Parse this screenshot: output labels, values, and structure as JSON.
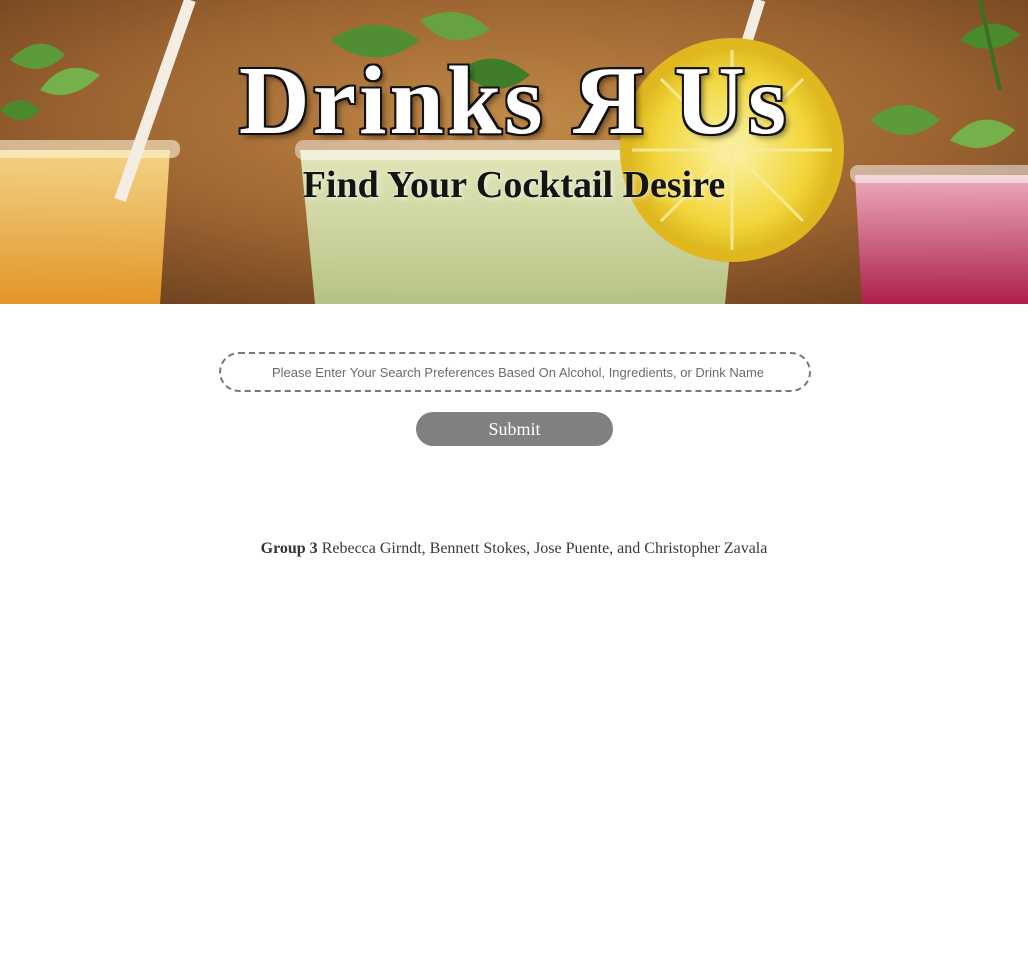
{
  "hero": {
    "title": "Drinks Я Us",
    "subtitle": "Find Your Cocktail Desire",
    "image": "cocktail-glasses-photo"
  },
  "search": {
    "placeholder": "Please Enter Your Search Preferences Based On Alcohol, Ingredients, or Drink Name",
    "value": "",
    "submit_label": "Submit"
  },
  "credits": {
    "group_label": "Group 3",
    "members": "Rebecca Girndt, Bennett Stokes, Jose Puente, and Christopher Zavala"
  },
  "colors": {
    "submit_bg": "#808080",
    "input_border": "#777777"
  }
}
